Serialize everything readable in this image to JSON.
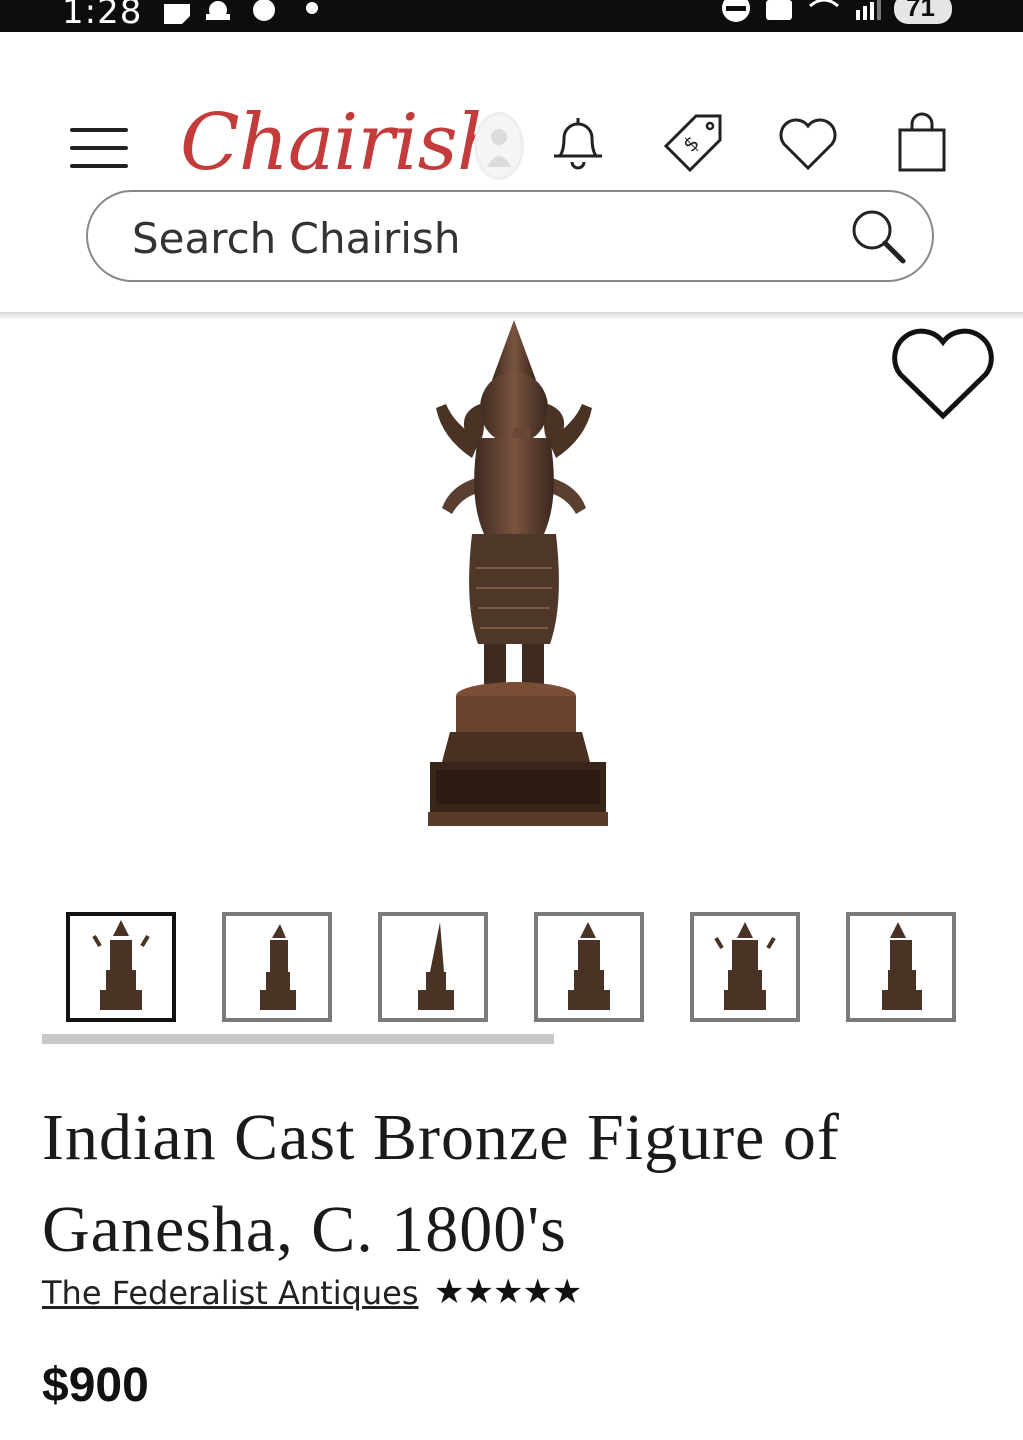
{
  "status_bar": {
    "time": "1:28",
    "battery": "71"
  },
  "header": {
    "logo_text": "Chairish",
    "icons": [
      "menu-icon",
      "avatar-icon",
      "bell-icon",
      "price-tag-icon",
      "heart-icon",
      "shopping-bag-icon"
    ]
  },
  "search": {
    "placeholder": "Search Chairish"
  },
  "product": {
    "title": "Indian Cast Bronze Figure of Ganesha, C. 1800's",
    "seller": "The Federalist Antiques",
    "rating_stars": "★★★★★",
    "rating": 5,
    "price": "$900",
    "thumbnail_count": 6,
    "active_thumbnail": 1
  },
  "colors": {
    "brand": "#c33b3b",
    "bronze": "#5a3f30"
  }
}
